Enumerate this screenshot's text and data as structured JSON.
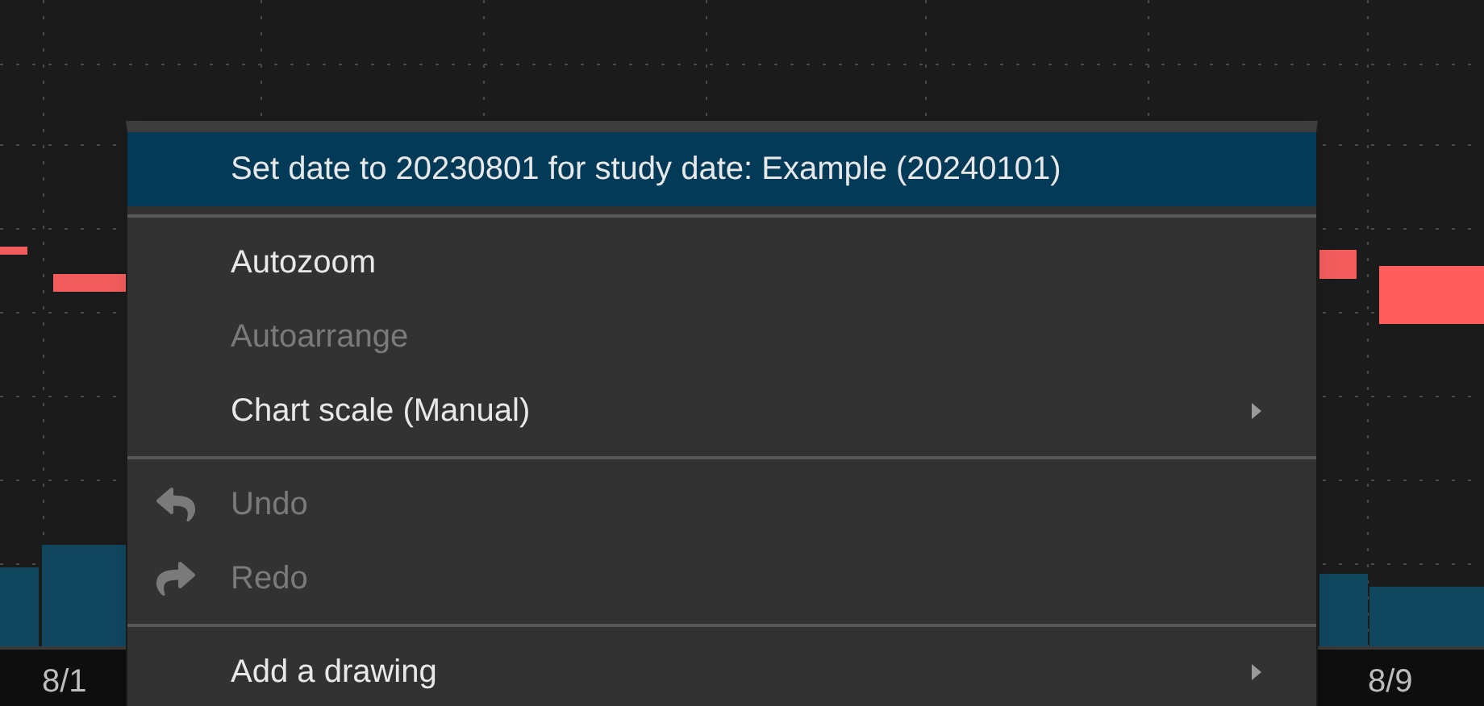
{
  "chart": {
    "x_labels": [
      "8/1",
      "8/9"
    ]
  },
  "menu": {
    "items": [
      {
        "kind": "item",
        "label": "Set date to 20230801 for study date: Example (20240101)",
        "selected": true,
        "disabled": false,
        "submenu": false
      },
      {
        "kind": "separator"
      },
      {
        "kind": "item",
        "label": "Autozoom",
        "selected": false,
        "disabled": false,
        "submenu": false
      },
      {
        "kind": "item",
        "label": "Autoarrange",
        "selected": false,
        "disabled": true,
        "submenu": false
      },
      {
        "kind": "item",
        "label": "Chart scale (Manual)",
        "selected": false,
        "disabled": false,
        "submenu": true
      },
      {
        "kind": "separator"
      },
      {
        "kind": "undo",
        "label": "Undo",
        "selected": false,
        "disabled": true,
        "submenu": false
      },
      {
        "kind": "redo",
        "label": "Redo",
        "selected": false,
        "disabled": true,
        "submenu": false
      },
      {
        "kind": "separator"
      },
      {
        "kind": "item",
        "label": "Add a drawing",
        "selected": false,
        "disabled": false,
        "submenu": true
      }
    ]
  }
}
